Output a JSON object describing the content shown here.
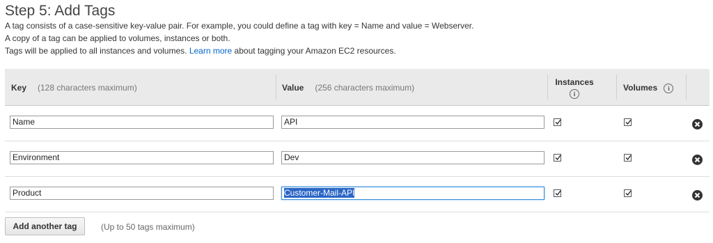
{
  "header": {
    "title": "Step 5: Add Tags",
    "line1": "A tag consists of a case-sensitive key-value pair. For example, you could define a tag with key = Name and value = Webserver.",
    "line2": "A copy of a tag can be applied to volumes, instances or both.",
    "line3_prefix": "Tags will be applied to all instances and volumes.",
    "line3_link": "Learn more",
    "line3_suffix": "about tagging your Amazon EC2 resources."
  },
  "table": {
    "key_header": "Key",
    "key_hint": "(128 characters maximum)",
    "value_header": "Value",
    "value_hint": "(256 characters maximum)",
    "instances_header": "Instances",
    "volumes_header": "Volumes",
    "info_icon": "i",
    "rows": [
      {
        "key": "Name",
        "value": "API",
        "instances": true,
        "volumes": true
      },
      {
        "key": "Environment",
        "value": "Dev",
        "instances": true,
        "volumes": true
      },
      {
        "key": "Product",
        "value": "Customer-Mail-API",
        "instances": true,
        "volumes": true
      }
    ]
  },
  "footer": {
    "add_button": "Add another tag",
    "limit_text": "(Up to 50 tags maximum)"
  },
  "colors": {
    "link": "#0066cc",
    "header_bg": "#eaeaea",
    "selection": "#2a66c6"
  }
}
